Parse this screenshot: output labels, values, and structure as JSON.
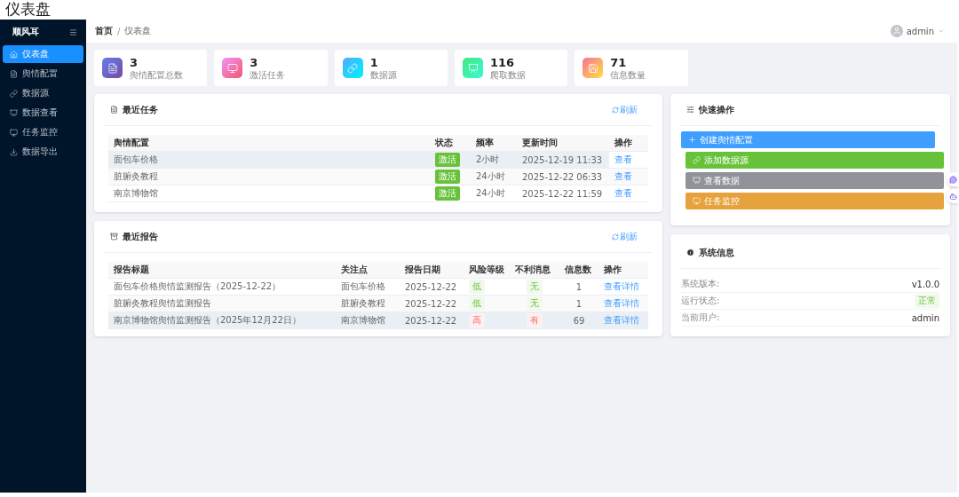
{
  "page_title": "仪表盘",
  "sidebar": {
    "brand": "顺风耳",
    "items": [
      {
        "label": "仪表盘",
        "kind": "home",
        "selected": true
      },
      {
        "label": "舆情配置",
        "kind": "document",
        "selected": false
      },
      {
        "label": "数据源",
        "kind": "link",
        "selected": false
      },
      {
        "label": "数据查看",
        "kind": "easel",
        "selected": false
      },
      {
        "label": "任务监控",
        "kind": "monitor",
        "selected": false
      },
      {
        "label": "数据导出",
        "kind": "download",
        "selected": false
      }
    ]
  },
  "header": {
    "breadcrumb": [
      "首页",
      "仪表盘"
    ],
    "breadcrumb_separator": "/",
    "user": "admin"
  },
  "stats": [
    {
      "value": "3",
      "label": "舆情配置总数",
      "kind": "document"
    },
    {
      "value": "3",
      "label": "激活任务",
      "kind": "monitor"
    },
    {
      "value": "1",
      "label": "数据源",
      "kind": "link"
    },
    {
      "value": "116",
      "label": "爬取数据",
      "kind": "easel"
    },
    {
      "value": "71",
      "label": "信息数量",
      "kind": "save"
    }
  ],
  "recent_tasks": {
    "title": "最近任务",
    "refresh": "刷新",
    "columns": [
      "舆情配置",
      "状态",
      "频率",
      "更新时间",
      "操作"
    ],
    "rows": [
      {
        "config": "面包车价格",
        "status": "激活",
        "frequency": "2小时",
        "updated": "2025-12-19 11:33",
        "action": "查看",
        "highlighted": true
      },
      {
        "config": "脏腑灸教程",
        "status": "激活",
        "frequency": "24小时",
        "updated": "2025-12-22 06:33",
        "action": "查看",
        "highlighted": false
      },
      {
        "config": "南京博物馆",
        "status": "激活",
        "frequency": "24小时",
        "updated": "2025-12-22 11:59",
        "action": "查看",
        "highlighted": false
      }
    ]
  },
  "recent_reports": {
    "title": "最近报告",
    "refresh": "刷新",
    "columns": [
      "报告标题",
      "关注点",
      "报告日期",
      "风险等级",
      "不利消息",
      "信息数",
      "操作"
    ],
    "rows": [
      {
        "title": "面包车价格舆情监测报告（2025-12-22）",
        "focus": "面包车价格",
        "date": "2025-12-22",
        "risk": {
          "text": "低",
          "kind": "success"
        },
        "negative": {
          "text": "无",
          "kind": "success"
        },
        "count": "1",
        "action": "查看详情",
        "highlighted": false
      },
      {
        "title": "脏腑灸教程舆情监测报告",
        "focus": "脏腑灸教程",
        "date": "2025-12-22",
        "risk": {
          "text": "低",
          "kind": "success"
        },
        "negative": {
          "text": "无",
          "kind": "success"
        },
        "count": "1",
        "action": "查看详情",
        "highlighted": false
      },
      {
        "title": "南京博物馆舆情监测报告（2025年12月22日）",
        "focus": "南京博物馆",
        "date": "2025-12-22",
        "risk": {
          "text": "高",
          "kind": "danger"
        },
        "negative": {
          "text": "有",
          "kind": "danger"
        },
        "count": "69",
        "action": "查看详情",
        "highlighted": true
      }
    ]
  },
  "quick_actions": {
    "title": "快速操作",
    "buttons": [
      {
        "label": "创建舆情配置",
        "kind": "primary"
      },
      {
        "label": "添加数据源",
        "kind": "success"
      },
      {
        "label": "查看数据",
        "kind": "info"
      },
      {
        "label": "任务监控",
        "kind": "warning"
      }
    ]
  },
  "system_info": {
    "title": "系统信息",
    "rows": [
      {
        "label": "系统版本:",
        "value": "v1.0.0",
        "kind": "text"
      },
      {
        "label": "运行状态:",
        "value": "正常",
        "kind": "tag"
      },
      {
        "label": "当前用户:",
        "value": "admin",
        "kind": "text"
      }
    ]
  }
}
